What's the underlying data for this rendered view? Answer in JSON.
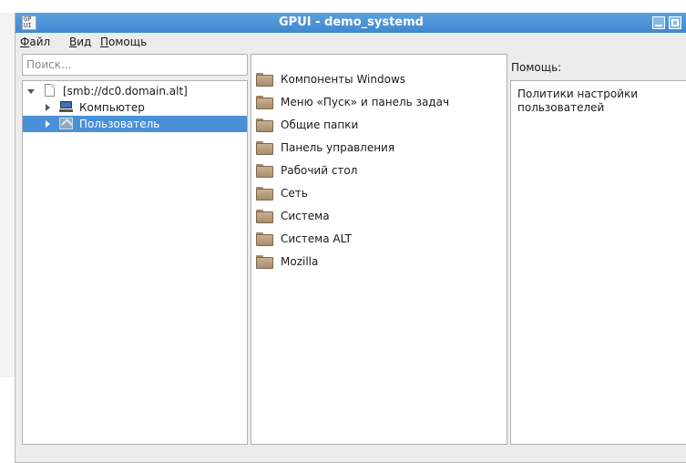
{
  "window": {
    "title": "GPUI - demo_systemd",
    "app_icon_text": "GP UI"
  },
  "menubar": {
    "items": [
      {
        "mnemonic": "Ф",
        "rest": "айл"
      },
      {
        "mnemonic": "В",
        "rest": "ид"
      },
      {
        "mnemonic": "П",
        "rest": "омощь"
      }
    ]
  },
  "search": {
    "placeholder": "Поиск...",
    "value": ""
  },
  "tree": {
    "root": {
      "label": "[smb://dc0.domain.alt]",
      "icon": "document-icon",
      "expanded": true
    },
    "children": [
      {
        "label": "Компьютер",
        "icon": "computer-icon",
        "selected": false
      },
      {
        "label": "Пользователь",
        "icon": "user-icon",
        "selected": true
      }
    ]
  },
  "list": {
    "items": [
      "Компоненты Windows",
      "Меню «Пуск» и панель задач",
      "Общие папки",
      "Панель управления",
      "Рабочий стол",
      "Сеть",
      "Система",
      "Система ALT",
      "Mozilla"
    ],
    "item_icon": "folder-icon"
  },
  "help": {
    "label": "Помощь:",
    "text": "Политики настройки пользователей"
  },
  "colors": {
    "titlebar": "#4a90d9",
    "selection": "#4a90d9",
    "folder": "#b89c7a"
  }
}
